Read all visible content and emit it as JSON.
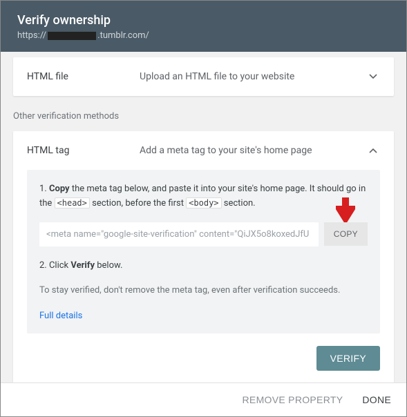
{
  "header": {
    "title": "Verify ownership",
    "url_prefix": "https://",
    "url_suffix": ".tumblr.com/"
  },
  "html_file": {
    "name": "HTML file",
    "desc": "Upload an HTML file to your website"
  },
  "other_label": "Other verification methods",
  "html_tag": {
    "name": "HTML tag",
    "desc": "Add a meta tag to your site's home page",
    "step1_a": "1. ",
    "step1_b": "Copy",
    "step1_c": " the meta tag below, and paste it into your site's home page. It should go in the ",
    "step1_head": "<head>",
    "step1_d": " section, before the first ",
    "step1_body": "<body>",
    "step1_e": " section.",
    "meta_value": "<meta name=\"google-site-verification\" content=\"QiJX5o8koxedJfU",
    "copy": "COPY",
    "step2_a": "2. Click ",
    "step2_b": "Verify",
    "step2_c": " below.",
    "note": "To stay verified, don't remove the meta tag, even after verification succeeds.",
    "details": "Full details",
    "verify": "VERIFY"
  },
  "footer": {
    "remove": "REMOVE PROPERTY",
    "done": "DONE"
  }
}
